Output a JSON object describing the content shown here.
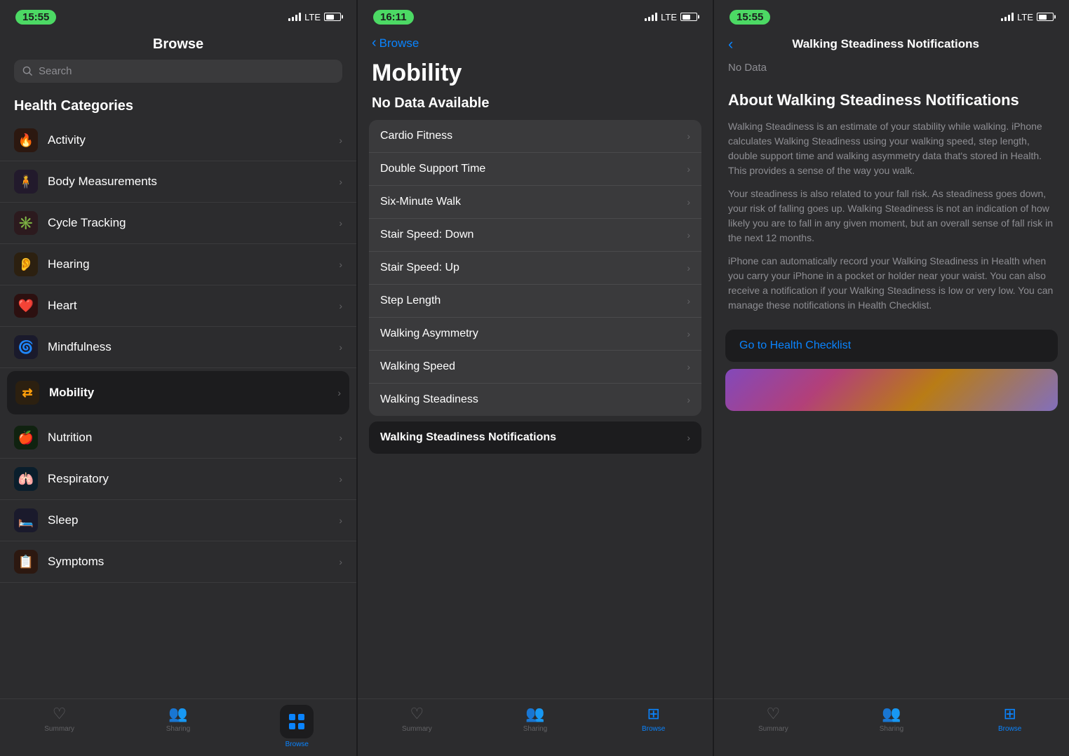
{
  "phone1": {
    "status": {
      "time": "15:55",
      "carrier": "LTE"
    },
    "header": {
      "title": "Browse",
      "search_placeholder": "Search"
    },
    "health_categories_label": "Health Categories",
    "categories": [
      {
        "name": "Activity",
        "icon": "🔥",
        "color": "#ff6b35",
        "selected": false
      },
      {
        "name": "Body Measurements",
        "icon": "🧍",
        "color": "#af52de",
        "selected": false
      },
      {
        "name": "Cycle Tracking",
        "icon": "✳️",
        "color": "#ff2d55",
        "selected": false
      },
      {
        "name": "Hearing",
        "icon": "👂",
        "color": "#ff9f0a",
        "selected": false
      },
      {
        "name": "Heart",
        "icon": "❤️",
        "color": "#ff3b30",
        "selected": false
      },
      {
        "name": "Mindfulness",
        "icon": "🌀",
        "color": "#5e5ce6",
        "selected": false
      },
      {
        "name": "Mobility",
        "icon": "⇄",
        "color": "#ff9f0a",
        "selected": true
      },
      {
        "name": "Nutrition",
        "icon": "🍎",
        "color": "#30d158",
        "selected": false
      },
      {
        "name": "Respiratory",
        "icon": "🫁",
        "color": "#5ac8fa",
        "selected": false
      },
      {
        "name": "Sleep",
        "icon": "🛏️",
        "color": "#5e5ce6",
        "selected": false
      },
      {
        "name": "Symptoms",
        "icon": "📋",
        "color": "#ff6b35",
        "selected": false
      }
    ],
    "tabs": [
      {
        "label": "Summary",
        "icon": "♥",
        "active": false
      },
      {
        "label": "Sharing",
        "icon": "👥",
        "active": false
      },
      {
        "label": "Browse",
        "icon": "grid",
        "active": true
      }
    ]
  },
  "phone2": {
    "status": {
      "time": "16:11",
      "carrier": "LTE"
    },
    "nav": {
      "back_label": "Browse"
    },
    "page_title": "Mobility",
    "no_data_label": "No Data Available",
    "items": [
      {
        "name": "Cardio Fitness",
        "highlighted": false
      },
      {
        "name": "Double Support Time",
        "highlighted": false
      },
      {
        "name": "Six-Minute Walk",
        "highlighted": false
      },
      {
        "name": "Stair Speed: Down",
        "highlighted": false
      },
      {
        "name": "Stair Speed: Up",
        "highlighted": false
      },
      {
        "name": "Step Length",
        "highlighted": false
      },
      {
        "name": "Walking Asymmetry",
        "highlighted": false
      },
      {
        "name": "Walking Speed",
        "highlighted": false
      },
      {
        "name": "Walking Steadiness",
        "highlighted": false
      },
      {
        "name": "Walking Steadiness Notifications",
        "highlighted": true
      }
    ],
    "tabs": [
      {
        "label": "Summary",
        "icon": "♥",
        "active": false
      },
      {
        "label": "Sharing",
        "icon": "👥",
        "active": false
      },
      {
        "label": "Browse",
        "icon": "grid",
        "active": true
      }
    ]
  },
  "phone3": {
    "status": {
      "time": "15:55",
      "carrier": "LTE"
    },
    "nav": {
      "title": "Walking Steadiness Notifications",
      "back_label": ""
    },
    "no_data": "No Data",
    "about": {
      "title": "About Walking Steadiness Notifications",
      "paragraphs": [
        "Walking Steadiness is an estimate of your stability while walking. iPhone calculates Walking Steadiness using your walking speed, step length, double support time and walking asymmetry data that's stored in Health. This provides a sense of the way you walk.",
        "Your steadiness is also related to your fall risk. As steadiness goes down, your risk of falling goes up. Walking Steadiness is not an indication of how likely you are to fall in any given moment, but an overall sense of fall risk in the next 12 months.",
        "iPhone can automatically record your Walking Steadiness in Health when you carry your iPhone in a pocket or holder near your waist. You can also receive a notification if your Walking Steadiness is low or very low. You can manage these notifications in Health Checklist."
      ],
      "checklist_label": "Go to Health Checklist"
    },
    "tabs": [
      {
        "label": "Summary",
        "icon": "♥",
        "active": false
      },
      {
        "label": "Sharing",
        "icon": "👥",
        "active": false
      },
      {
        "label": "Browse",
        "icon": "grid",
        "active": true
      }
    ]
  }
}
